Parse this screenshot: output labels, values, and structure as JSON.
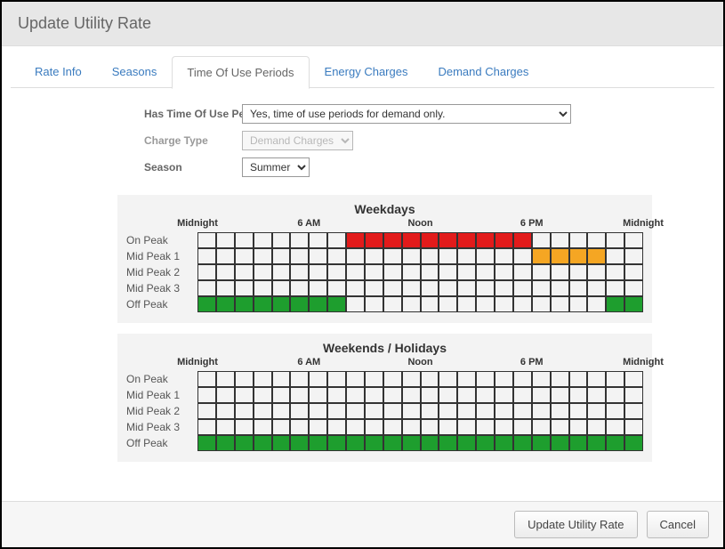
{
  "title": "Update Utility Rate",
  "tabs": {
    "rate_info": "Rate Info",
    "seasons": "Seasons",
    "tou": "Time Of Use Periods",
    "energy": "Energy Charges",
    "demand": "Demand Charges"
  },
  "form": {
    "has_tou_label": "Has Time Of Use Periods",
    "has_tou_value": "Yes, time of use periods for demand only.",
    "charge_type_label": "Charge Type",
    "charge_type_value": "Demand Charges",
    "season_label": "Season",
    "season_value": "Summer"
  },
  "hour_labels": {
    "h0": "Midnight",
    "h6": "6 AM",
    "h12": "Noon",
    "h18": "6 PM",
    "h24": "Midnight"
  },
  "row_labels": {
    "on_peak": "On Peak",
    "mid1": "Mid Peak 1",
    "mid2": "Mid Peak 2",
    "mid3": "Mid Peak 3",
    "off_peak": "Off Peak"
  },
  "schedules": {
    "weekdays": {
      "title": "Weekdays",
      "on_peak": [
        "",
        "",
        "",
        "",
        "",
        "",
        "",
        "",
        "red",
        "red",
        "red",
        "red",
        "red",
        "red",
        "red",
        "red",
        "red",
        "red",
        "",
        "",
        "",
        "",
        "",
        ""
      ],
      "mid1": [
        "",
        "",
        "",
        "",
        "",
        "",
        "",
        "",
        "",
        "",
        "",
        "",
        "",
        "",
        "",
        "",
        "",
        "",
        "orange",
        "orange",
        "orange",
        "orange",
        "",
        ""
      ],
      "mid2": [
        "",
        "",
        "",
        "",
        "",
        "",
        "",
        "",
        "",
        "",
        "",
        "",
        "",
        "",
        "",
        "",
        "",
        "",
        "",
        "",
        "",
        "",
        "",
        ""
      ],
      "mid3": [
        "",
        "",
        "",
        "",
        "",
        "",
        "",
        "",
        "",
        "",
        "",
        "",
        "",
        "",
        "",
        "",
        "",
        "",
        "",
        "",
        "",
        "",
        "",
        ""
      ],
      "off_peak": [
        "green",
        "green",
        "green",
        "green",
        "green",
        "green",
        "green",
        "green",
        "",
        "",
        "",
        "",
        "",
        "",
        "",
        "",
        "",
        "",
        "",
        "",
        "",
        "",
        "green",
        "green"
      ]
    },
    "weekends": {
      "title": "Weekends / Holidays",
      "on_peak": [
        "",
        "",
        "",
        "",
        "",
        "",
        "",
        "",
        "",
        "",
        "",
        "",
        "",
        "",
        "",
        "",
        "",
        "",
        "",
        "",
        "",
        "",
        "",
        ""
      ],
      "mid1": [
        "",
        "",
        "",
        "",
        "",
        "",
        "",
        "",
        "",
        "",
        "",
        "",
        "",
        "",
        "",
        "",
        "",
        "",
        "",
        "",
        "",
        "",
        "",
        ""
      ],
      "mid2": [
        "",
        "",
        "",
        "",
        "",
        "",
        "",
        "",
        "",
        "",
        "",
        "",
        "",
        "",
        "",
        "",
        "",
        "",
        "",
        "",
        "",
        "",
        "",
        ""
      ],
      "mid3": [
        "",
        "",
        "",
        "",
        "",
        "",
        "",
        "",
        "",
        "",
        "",
        "",
        "",
        "",
        "",
        "",
        "",
        "",
        "",
        "",
        "",
        "",
        "",
        ""
      ],
      "off_peak": [
        "green",
        "green",
        "green",
        "green",
        "green",
        "green",
        "green",
        "green",
        "green",
        "green",
        "green",
        "green",
        "green",
        "green",
        "green",
        "green",
        "green",
        "green",
        "green",
        "green",
        "green",
        "green",
        "green",
        "green"
      ]
    }
  },
  "buttons": {
    "update": "Update Utility Rate",
    "cancel": "Cancel"
  }
}
